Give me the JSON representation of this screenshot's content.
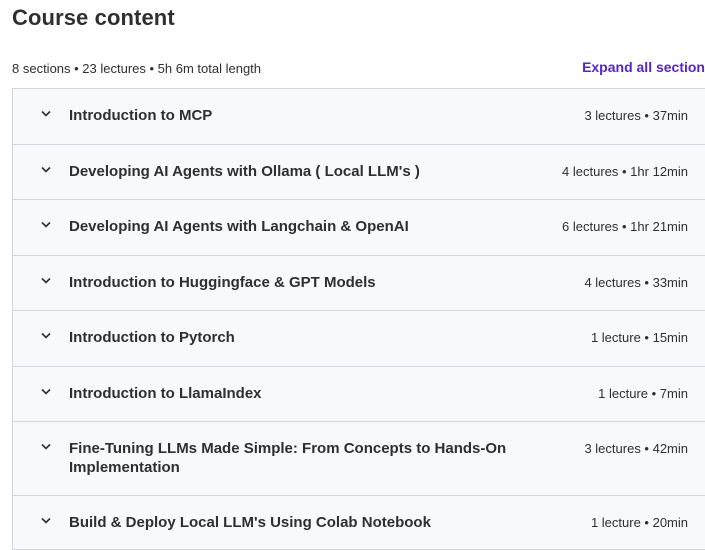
{
  "header": {
    "title": "Course content",
    "summary": "8 sections • 23 lectures • 5h 6m total length",
    "expand_label": "Expand all section"
  },
  "sections": [
    {
      "title": "Introduction to MCP",
      "meta": "3 lectures • 37min"
    },
    {
      "title": "Developing AI Agents with Ollama ( Local LLM's )",
      "meta": "4 lectures • 1hr 12min"
    },
    {
      "title": "Developing AI Agents with Langchain & OpenAI",
      "meta": "6 lectures • 1hr 21min"
    },
    {
      "title": "Introduction to Huggingface & GPT Models",
      "meta": "4 lectures • 33min"
    },
    {
      "title": "Introduction to Pytorch",
      "meta": "1 lecture • 15min"
    },
    {
      "title": "Introduction to LlamaIndex",
      "meta": "1 lecture • 7min"
    },
    {
      "title": "Fine-Tuning LLMs Made Simple: From Concepts to Hands-On Implementation",
      "meta": "3 lectures • 42min"
    },
    {
      "title": "Build & Deploy Local LLM's Using Colab Notebook",
      "meta": "1 lecture • 20min"
    }
  ],
  "icons": {
    "section_toggle": "chevron-down-icon"
  },
  "colors": {
    "accent": "#5624d0",
    "text": "#2d2f31",
    "section_bg": "#f7f9fa",
    "border": "#d1d7dc"
  }
}
